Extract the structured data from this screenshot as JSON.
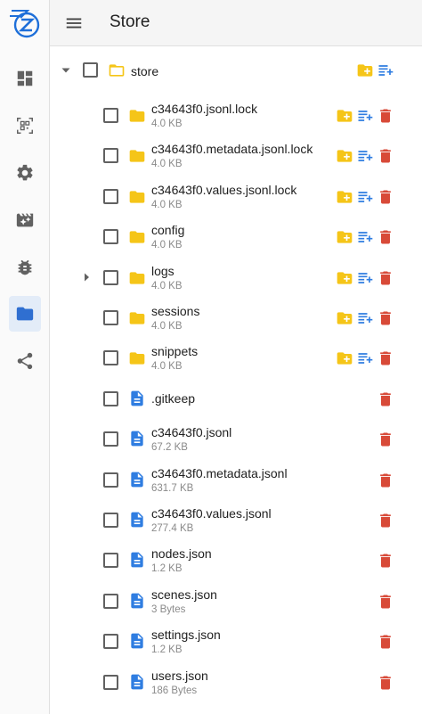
{
  "app": {
    "title": "Store"
  },
  "root": {
    "name": "store"
  },
  "items": [
    {
      "name": "c34643f0.jsonl.lock",
      "size": "4.0 KB",
      "type": "folder",
      "expandable": false
    },
    {
      "name": "c34643f0.metadata.jsonl.lock",
      "size": "4.0 KB",
      "type": "folder",
      "expandable": false
    },
    {
      "name": "c34643f0.values.jsonl.lock",
      "size": "4.0 KB",
      "type": "folder",
      "expandable": false
    },
    {
      "name": "config",
      "size": "4.0 KB",
      "type": "folder",
      "expandable": false
    },
    {
      "name": "logs",
      "size": "4.0 KB",
      "type": "folder",
      "expandable": true
    },
    {
      "name": "sessions",
      "size": "4.0 KB",
      "type": "folder",
      "expandable": false
    },
    {
      "name": "snippets",
      "size": "4.0 KB",
      "type": "folder",
      "expandable": false
    },
    {
      "name": ".gitkeep",
      "size": "",
      "type": "file",
      "expandable": false
    },
    {
      "name": "c34643f0.jsonl",
      "size": "67.2 KB",
      "type": "file",
      "expandable": false
    },
    {
      "name": "c34643f0.metadata.jsonl",
      "size": "631.7 KB",
      "type": "file",
      "expandable": false
    },
    {
      "name": "c34643f0.values.jsonl",
      "size": "277.4 KB",
      "type": "file",
      "expandable": false
    },
    {
      "name": "nodes.json",
      "size": "1.2 KB",
      "type": "file",
      "expandable": false
    },
    {
      "name": "scenes.json",
      "size": "3 Bytes",
      "type": "file",
      "expandable": false
    },
    {
      "name": "settings.json",
      "size": "1.2 KB",
      "type": "file",
      "expandable": false
    },
    {
      "name": "users.json",
      "size": "186 Bytes",
      "type": "file",
      "expandable": false
    }
  ],
  "nav": [
    {
      "icon": "dashboard-icon",
      "active": false
    },
    {
      "icon": "qr-code-scanner-icon",
      "active": false
    },
    {
      "icon": "settings-gear-icon",
      "active": false
    },
    {
      "icon": "movie-filter-icon",
      "active": false
    },
    {
      "icon": "bug-icon",
      "active": false
    },
    {
      "icon": "folder-icon",
      "active": true
    },
    {
      "icon": "share-icon",
      "active": false
    }
  ],
  "colors": {
    "folder": "#f5c518",
    "file": "#2f7de1",
    "delete": "#d84a38",
    "rail_icon": "#616161",
    "rail_active": "#2f6fd1",
    "logo": "#1e6fd9"
  }
}
